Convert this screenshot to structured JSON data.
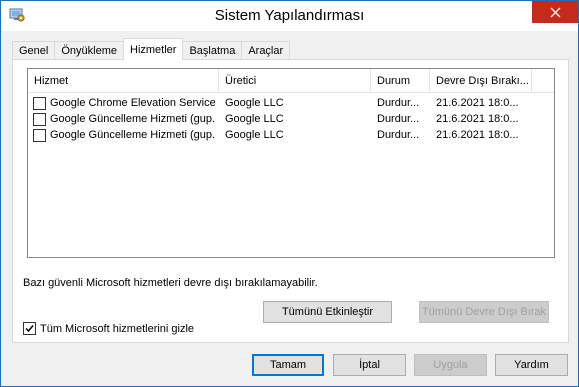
{
  "window": {
    "title": "Sistem Yapılandırması",
    "close_glyph": "✕"
  },
  "tabs": [
    {
      "label": "Genel",
      "active": false
    },
    {
      "label": "Önyükleme",
      "active": false
    },
    {
      "label": "Hizmetler",
      "active": true
    },
    {
      "label": "Başlatma",
      "active": false
    },
    {
      "label": "Araçlar",
      "active": false
    }
  ],
  "services": {
    "columns": [
      "Hizmet",
      "Üretici",
      "Durum",
      "Devre Dışı Bırakı..."
    ],
    "rows": [
      {
        "checked": false,
        "name": "Google Chrome Elevation Service",
        "vendor": "Google LLC",
        "status": "Durdur...",
        "disabled_date": "21.6.2021 18:0..."
      },
      {
        "checked": false,
        "name": "Google Güncelleme Hizmeti (gup...",
        "vendor": "Google LLC",
        "status": "Durdur...",
        "disabled_date": "21.6.2021 18:0..."
      },
      {
        "checked": false,
        "name": "Google Güncelleme Hizmeti (gup...",
        "vendor": "Google LLC",
        "status": "Durdur...",
        "disabled_date": "21.6.2021 18:0..."
      }
    ]
  },
  "note": "Bazı güvenli Microsoft hizmetleri devre dışı bırakılamayabilir.",
  "buttons": {
    "enable_all": "Tümünü Etkinleştir",
    "disable_all": "Tümünü Devre Dışı Bırak",
    "ok": "Tamam",
    "cancel": "İptal",
    "apply": "Uygula",
    "help": "Yardım"
  },
  "hide_ms": {
    "label": "Tüm Microsoft hizmetlerini gizle",
    "checked": true
  }
}
